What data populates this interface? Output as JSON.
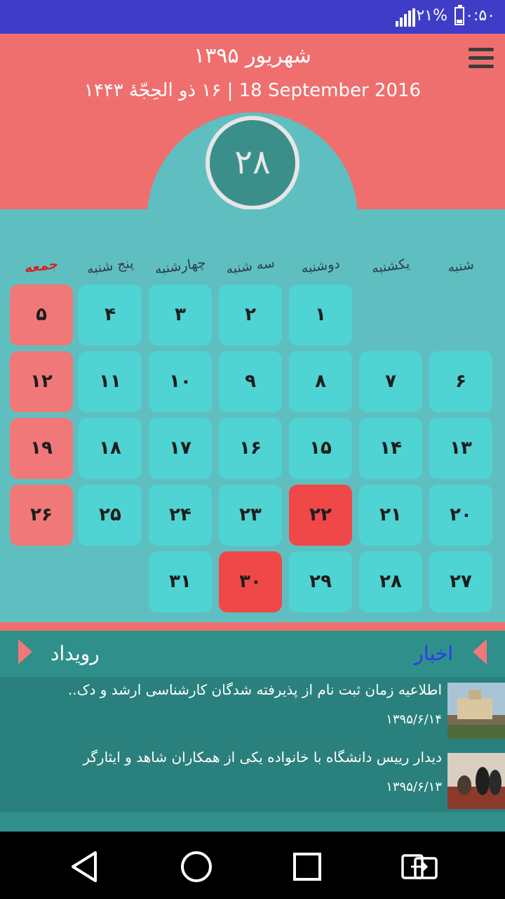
{
  "status_bar": {
    "time": "۰:۵۰",
    "battery_percent": "۲۱%"
  },
  "header": {
    "persian_month_year": "شهریور ۱۳۹۵",
    "gregorian_date": "18 September 2016",
    "separator": "|",
    "hijri_date": "۱۶ ذو الحِجّهٔ ۱۴۴۳",
    "today": "۲۸"
  },
  "weekdays": [
    "شنبه",
    "یکشنبه",
    "دوشنبه",
    "سه شنبه",
    "چهارشنبه",
    "پنج شنبه",
    "جمعه"
  ],
  "calendar": {
    "rows": [
      [
        "",
        "",
        "۱",
        "۲",
        "۳",
        "۴",
        "۵"
      ],
      [
        "۶",
        "۷",
        "۸",
        "۹",
        "۱۰",
        "۱۱",
        "۱۲"
      ],
      [
        "۱۳",
        "۱۴",
        "۱۵",
        "۱۶",
        "۱۷",
        "۱۸",
        "۱۹"
      ],
      [
        "۲۰",
        "۲۱",
        "۲۲",
        "۲۳",
        "۲۴",
        "۲۵",
        "۲۶"
      ],
      [
        "۲۷",
        "۲۸",
        "۲۹",
        "۳۰",
        "۳۱",
        "",
        ""
      ]
    ],
    "holidays": [
      "۲۲",
      "۳۰"
    ]
  },
  "tabs": {
    "news": "اخبار",
    "events": "رویداد"
  },
  "news": [
    {
      "title": "اطلاعیه زمان ثبت نام از پذیرفته شدگان کارشناسی ارشد و دک..",
      "date": "۱۳۹۵/۶/۱۴"
    },
    {
      "title": "دیدار رییس دانشگاه با خانواده یکی از همکاران شاهد و ایثارگر",
      "date": "۱۳۹۵/۶/۱۳"
    }
  ],
  "colors": {
    "status_bar": "#3f3dc8",
    "header": "#ef6f6f",
    "calendar_bg": "#5fbfc0",
    "cell": "#4fd3d3",
    "friday_cell": "#f07878",
    "holiday_cell": "#f04848",
    "news_bg": "#2f8f8a",
    "news_tab_active": "#2a3cf0"
  },
  "icons": [
    "signal-icon",
    "battery-icon",
    "menu-icon",
    "back-icon",
    "home-icon",
    "recents-icon",
    "screen-rotate-icon"
  ]
}
